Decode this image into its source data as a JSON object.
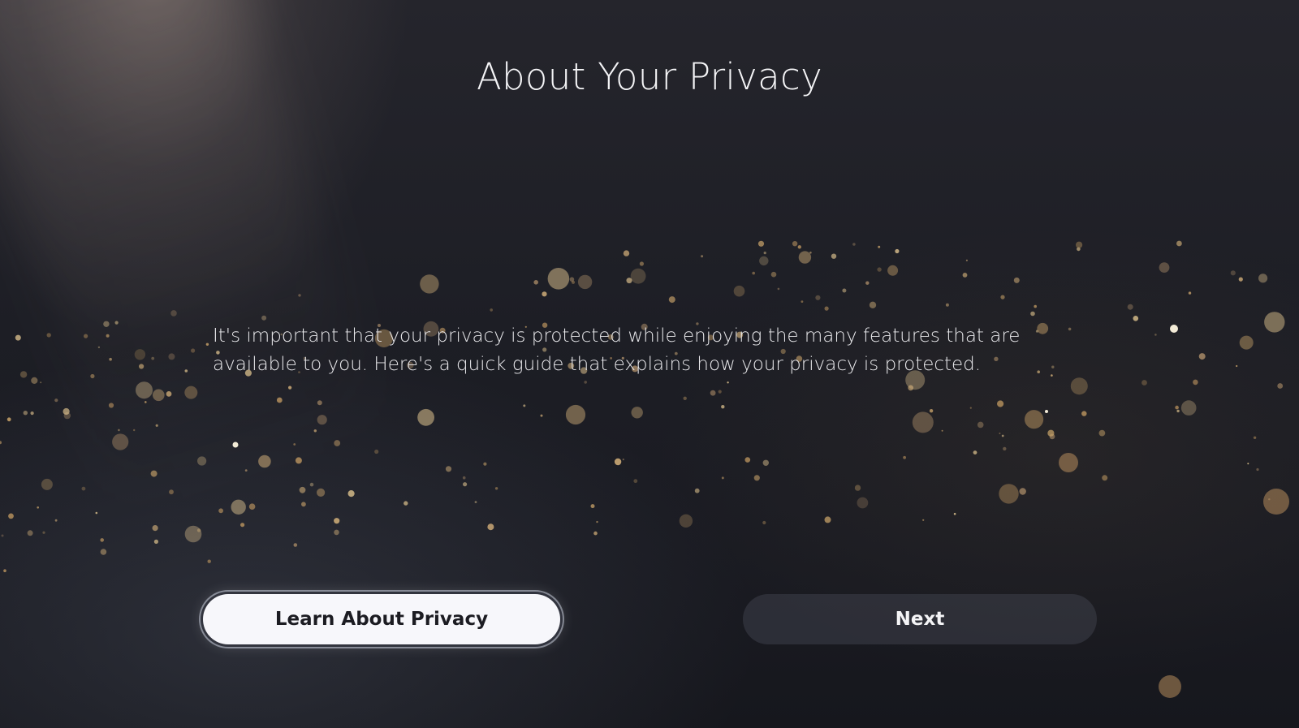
{
  "dialog": {
    "title": "About Your Privacy",
    "body": "It's important that your privacy is protected while enjoying the many features that are available to you. Here's a quick guide that explains how your privacy is protected."
  },
  "buttons": {
    "learn_label": "Learn About Privacy",
    "next_label": "Next"
  },
  "colors": {
    "background": "#1a1b22",
    "primary_button": "#f7f7fb",
    "secondary_button": "#3e404a",
    "particle_gold": "#c9a36a"
  }
}
